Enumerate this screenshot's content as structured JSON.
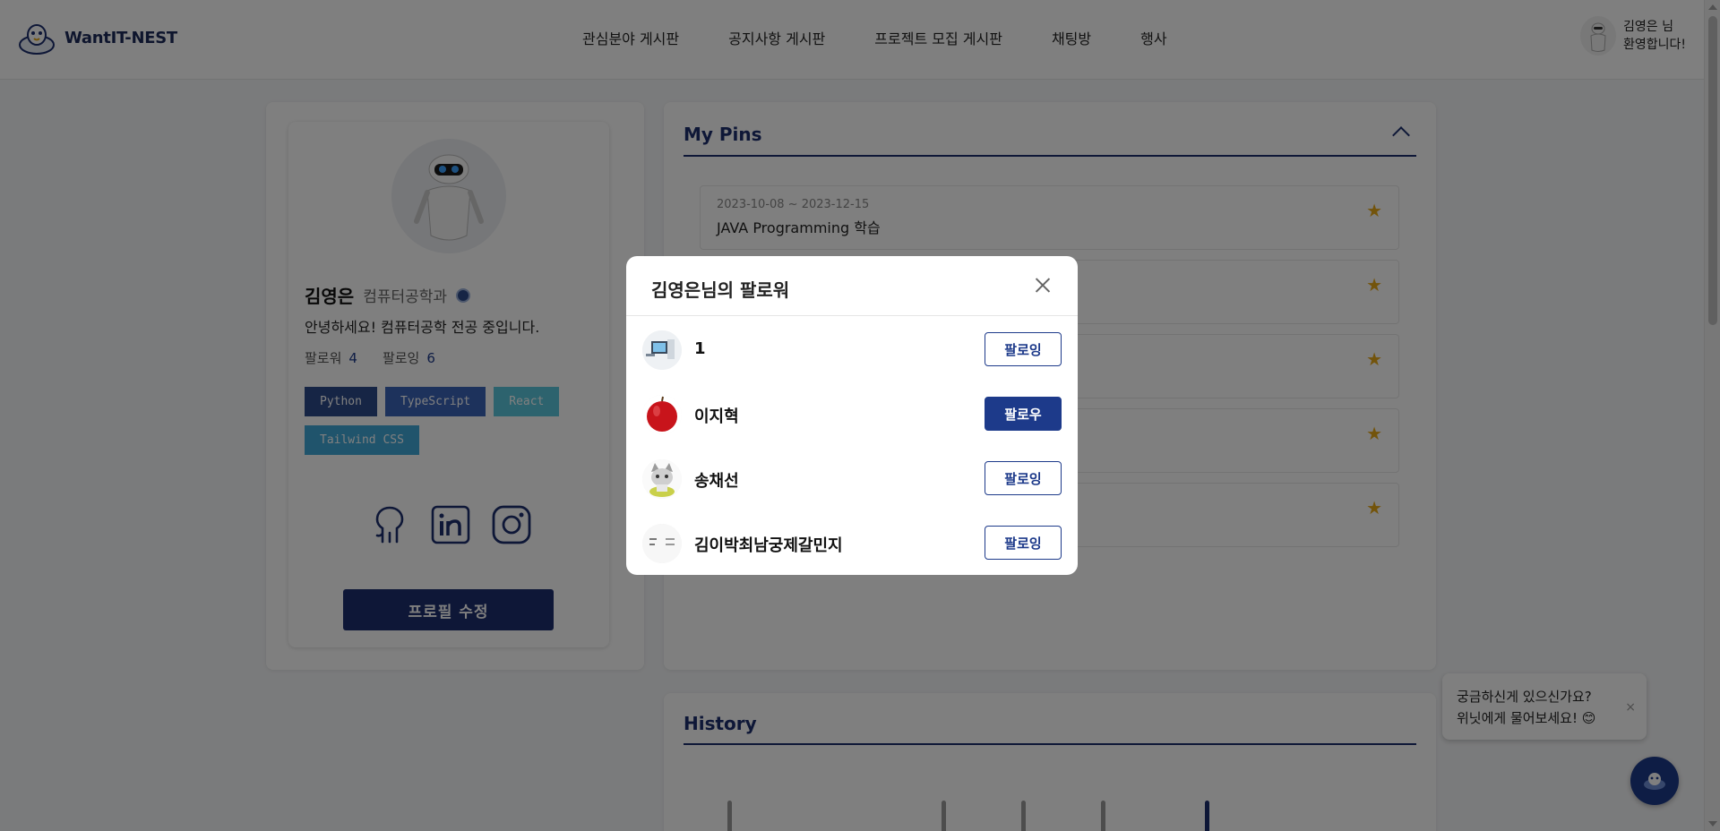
{
  "header": {
    "logo_text": "WantIT-NEST",
    "nav": [
      "관심분야 게시판",
      "공지사항 게시판",
      "프로젝트 모집 게시판",
      "채팅방",
      "행사"
    ],
    "user_line1": "김영은 님",
    "user_line2": "환영합니다!"
  },
  "profile": {
    "name": "김영은",
    "department": "컴퓨터공학과",
    "intro": "안녕하세요! 컴퓨터공학 전공 중입니다.",
    "followers_label": "팔로워",
    "followers_count": "4",
    "following_label": "팔로잉",
    "following_count": "6",
    "tags": [
      {
        "label": "Python",
        "color": "#2d4a8a"
      },
      {
        "label": "TypeScript",
        "color": "#3a64b8"
      },
      {
        "label": "React",
        "color": "#5bc6dc"
      },
      {
        "label": "Tailwind CSS",
        "color": "#41a8d8"
      }
    ],
    "socials": [
      "github-icon",
      "linkedin-icon",
      "instagram-icon"
    ],
    "edit_button": "프로필 수정"
  },
  "pins": {
    "title": "My Pins",
    "items": [
      {
        "date": "2023-10-08 ~ 2023-12-15",
        "title": "JAVA Programming 학습"
      },
      {
        "date": "",
        "title": ""
      },
      {
        "date": "",
        "title": ""
      },
      {
        "date": "",
        "title": ""
      },
      {
        "date": "",
        "title": ""
      }
    ]
  },
  "history": {
    "title": "History"
  },
  "chatbot": {
    "line1": "궁금하신게 있으신가요?",
    "line2": "위닛에게 물어보세요! 😊",
    "close": "×"
  },
  "modal": {
    "title": "김영은님의 팔로워",
    "followers": [
      {
        "name": "1",
        "button": "팔로잉",
        "primary": false
      },
      {
        "name": "이지혁",
        "button": "팔로우",
        "primary": true
      },
      {
        "name": "송채선",
        "button": "팔로잉",
        "primary": false
      },
      {
        "name": "김이박최남궁제갈민지",
        "button": "팔로잉",
        "primary": false
      }
    ]
  },
  "colors": {
    "brand_navy": "#1d2f6e",
    "accent_blue": "#1d3a8a",
    "star": "#e6a817"
  }
}
